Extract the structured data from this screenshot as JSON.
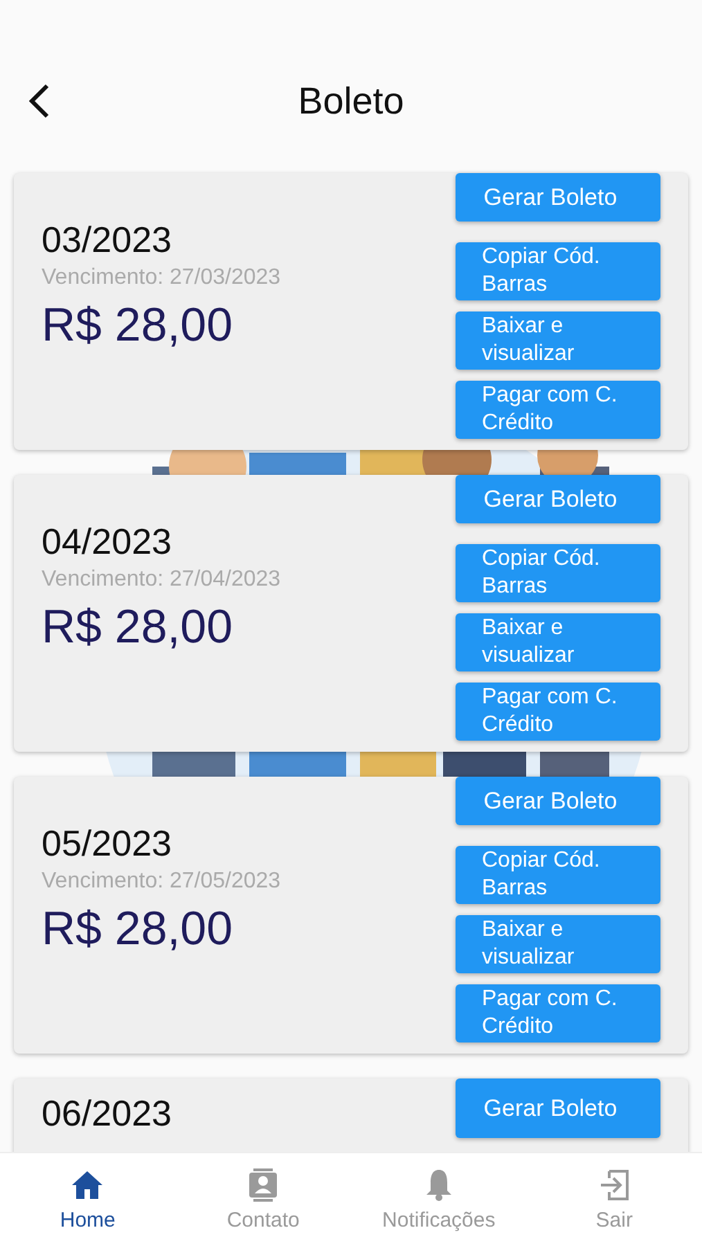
{
  "header": {
    "title": "Boleto"
  },
  "boletos": [
    {
      "period": "03/2023",
      "due": "Vencimento: 27/03/2023",
      "amount": "R$ 28,00",
      "buttons": [
        "Gerar Boleto",
        "Copiar Cód. Barras",
        "Baixar e visualizar",
        "Pagar com C. Crédito"
      ]
    },
    {
      "period": "04/2023",
      "due": "Vencimento: 27/04/2023",
      "amount": "R$ 28,00",
      "buttons": [
        "Gerar Boleto",
        "Copiar Cód. Barras",
        "Baixar e visualizar",
        "Pagar com C. Crédito"
      ]
    },
    {
      "period": "05/2023",
      "due": "Vencimento: 27/05/2023",
      "amount": "R$ 28,00",
      "buttons": [
        "Gerar Boleto",
        "Copiar Cód. Barras",
        "Baixar e visualizar",
        "Pagar com C. Crédito"
      ]
    },
    {
      "period": "06/2023",
      "buttons": [
        "Gerar Boleto"
      ]
    }
  ],
  "nav": [
    {
      "kind": "home",
      "label": "Home",
      "selected": true
    },
    {
      "kind": "contact",
      "label": "Contato",
      "selected": false
    },
    {
      "kind": "bell",
      "label": "Notificações",
      "selected": false
    },
    {
      "kind": "logout",
      "label": "Sair",
      "selected": false
    }
  ]
}
